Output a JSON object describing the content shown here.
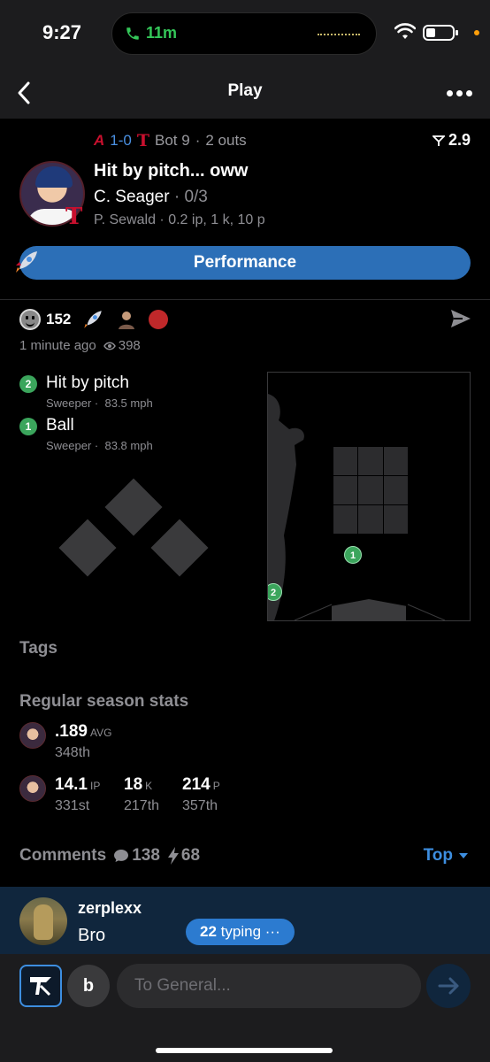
{
  "status_bar": {
    "time": "9:27",
    "call_duration": "11m"
  },
  "nav": {
    "title": "Play"
  },
  "game": {
    "away_logo": "A",
    "score": "1-0",
    "home_logo": "T",
    "inning": "Bot 9",
    "outs": "2 outs",
    "win_prob": "2.9"
  },
  "play": {
    "headline": "Hit by pitch... oww",
    "batter": "C. Seager",
    "batter_line": "0/3",
    "pitcher_line": "P. Sewald · 0.2 ip, 1 k, 10 p"
  },
  "performance_label": "Performance",
  "reactions": {
    "count": "152"
  },
  "meta": {
    "time_ago": "1 minute ago",
    "views": "398"
  },
  "pitches": [
    {
      "num": "2",
      "result": "Hit by pitch",
      "type": "Sweeper",
      "speed": "83.5 mph"
    },
    {
      "num": "1",
      "result": "Ball",
      "type": "Sweeper",
      "speed": "83.8 mph"
    }
  ],
  "sections": {
    "tags": "Tags",
    "season": "Regular season stats"
  },
  "batter_stats": {
    "avg": ".189",
    "avg_unit": "AVG",
    "avg_rank": "348th"
  },
  "pitcher_stats": [
    {
      "value": "14.1",
      "unit": "IP",
      "rank": "331st"
    },
    {
      "value": "18",
      "unit": "K",
      "rank": "217th"
    },
    {
      "value": "214",
      "unit": "P",
      "rank": "357th"
    }
  ],
  "comments": {
    "label": "Comments",
    "count": "138",
    "bolts": "68",
    "sort": "Top"
  },
  "latest_comment": {
    "user": "zerplexx",
    "text": "Bro"
  },
  "typing": {
    "count": "22",
    "label": "typing ···"
  },
  "compose": {
    "user_initial": "b",
    "placeholder": "To General..."
  },
  "colors": {
    "accent": "#2c6fb7",
    "pitch_green": "#3ba55c",
    "link": "#3d8ee0"
  }
}
